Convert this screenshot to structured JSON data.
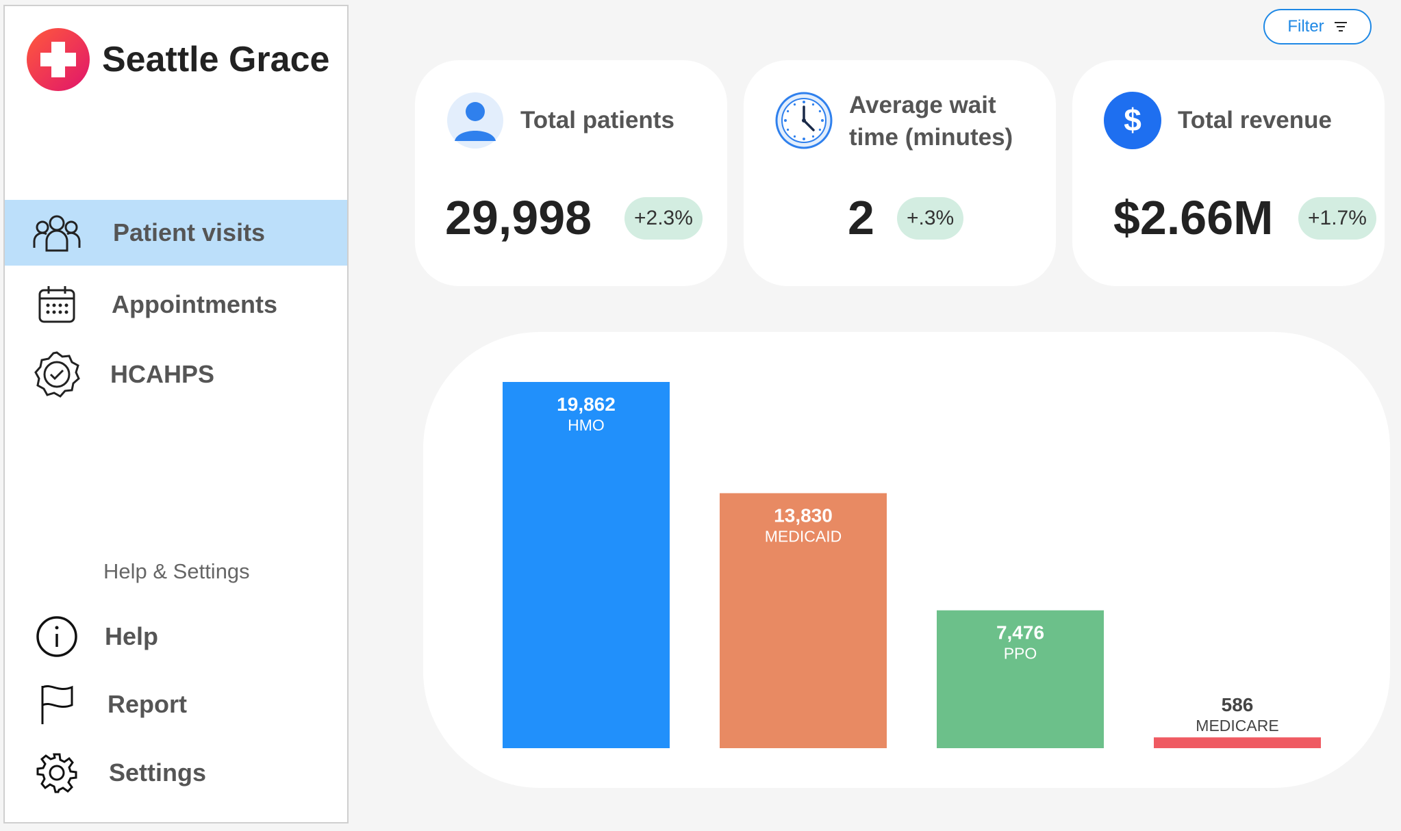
{
  "brand": {
    "name": "Seattle Grace"
  },
  "nav": {
    "primary": [
      {
        "label": "Patient visits",
        "icon": "people-icon",
        "active": true
      },
      {
        "label": "Appointments",
        "icon": "calendar-icon",
        "active": false
      },
      {
        "label": "HCAHPS",
        "icon": "badge-check-icon",
        "active": false
      }
    ],
    "section_label": "Help & Settings",
    "secondary": [
      {
        "label": "Help",
        "icon": "info-icon"
      },
      {
        "label": "Report",
        "icon": "flag-icon"
      },
      {
        "label": "Settings",
        "icon": "gear-icon"
      }
    ]
  },
  "toolbar": {
    "filter_label": "Filter"
  },
  "kpis": [
    {
      "title": "Total patients",
      "value": "29,998",
      "change": "+2.3%",
      "icon": "user-icon"
    },
    {
      "title_line1": "Average wait",
      "title_line2": "time (minutes)",
      "value": "2",
      "change": "+.3%",
      "icon": "clock-icon"
    },
    {
      "title": "Total revenue",
      "value": "$2.66M",
      "change": "+1.7%",
      "icon": "dollar-icon"
    }
  ],
  "colors": {
    "accent": "#1e88e5",
    "nav_active": "#bcdffa",
    "badge_bg": "#d3ede1",
    "bar_hmo": "#2190fb",
    "bar_medicaid": "#e88a63",
    "bar_ppo": "#6cc08a",
    "bar_medicare": "#ef5a62"
  },
  "chart_data": {
    "type": "bar",
    "categories": [
      "HMO",
      "MEDICAID",
      "PPO",
      "MEDICARE"
    ],
    "values": [
      19862,
      13830,
      7476,
      586
    ],
    "value_labels": [
      "19,862",
      "13,830",
      "7,476",
      "586"
    ],
    "colors": [
      "#2190fb",
      "#e88a63",
      "#6cc08a",
      "#ef5a62"
    ],
    "ylim": [
      0,
      19862
    ],
    "grid": false,
    "title": "",
    "xlabel": "",
    "ylabel": ""
  }
}
